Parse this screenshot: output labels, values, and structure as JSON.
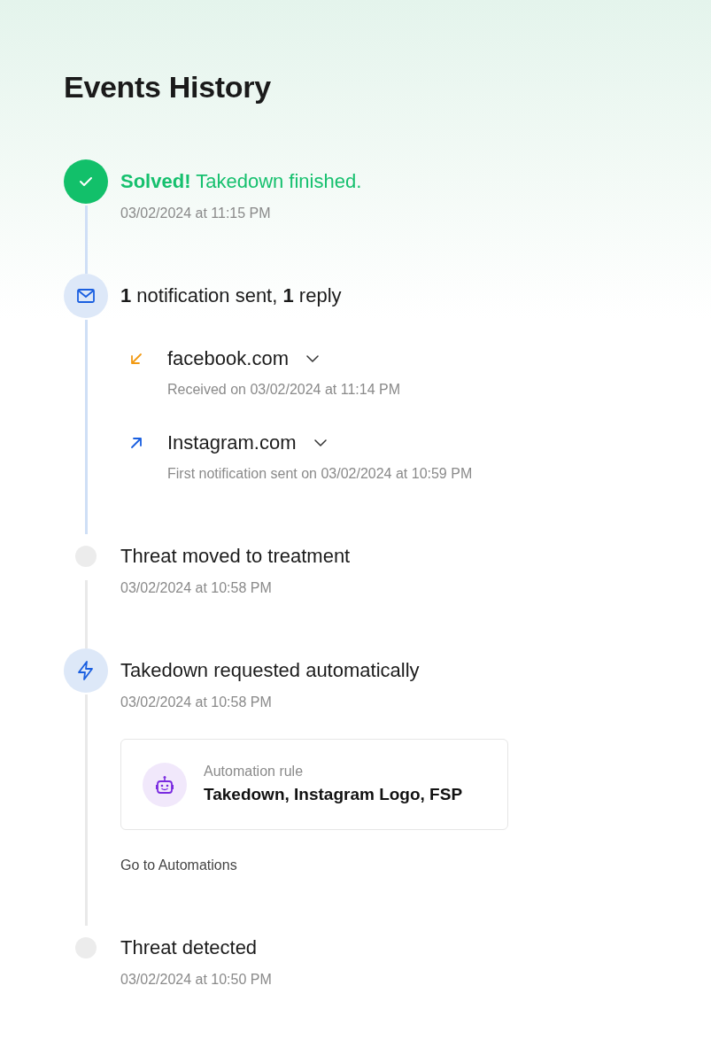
{
  "title": "Events History",
  "events": [
    {
      "kind": "solved",
      "title": "**Solved!** Takedown finished.",
      "time": "03/02/2024 at 11:15 PM"
    },
    {
      "kind": "notifications",
      "title": "**1** notification sent, **1** reply",
      "messages": [
        {
          "kind": "received",
          "domain": "facebook.com",
          "expanded": false,
          "detail": "Received on 03/02/2024 at 11:14 PM"
        },
        {
          "kind": "sent",
          "domain": "Instagram.com",
          "expanded": false,
          "detail": "First notification sent on 03/02/2024 at 10:59 PM"
        }
      ]
    },
    {
      "kind": "status",
      "title": "Threat moved to treatment",
      "time": "03/02/2024 at 10:58 PM"
    },
    {
      "kind": "automation",
      "title": "Takedown requested automatically",
      "time": "03/02/2024 at 10:58 PM",
      "rule": {
        "label": "Automation rule",
        "name": "Takedown, Instagram Logo, FSP"
      },
      "link": "Go to Automations"
    },
    {
      "kind": "status",
      "title": "Threat detected",
      "time": "03/02/2024 at 10:50 PM"
    }
  ]
}
